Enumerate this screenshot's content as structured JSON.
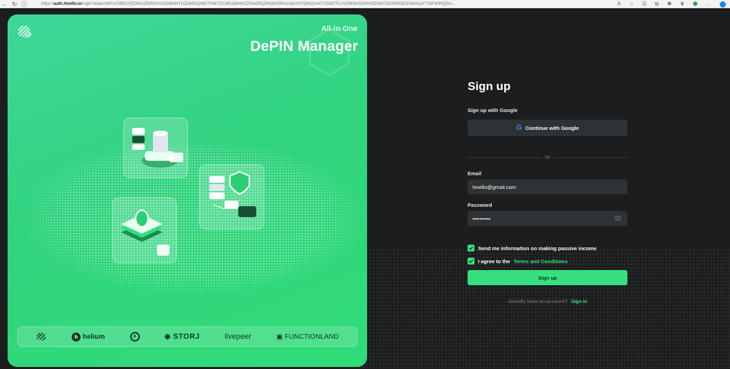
{
  "browser": {
    "url_prefix": "https://",
    "url_host": "auth.hivello.io",
    "url_rest": "/login?state=hKFo2SBEU0Q5MUdZM0hVU1ZkMk94Tk2Zdk9OQ8lDTXMrTEZaRUpWdVZZNa03RjZNKj8mR8UzUjeVVrYjNkQ1A4TU93dTFLUVZMSk05OHVGZHhjY2k25WhtdCEiMmhpYTGtFbHNQSm...",
    "nav_back": "←",
    "nav_reload": "↻",
    "nav_info": "ⓘ",
    "icons": [
      "A",
      "☆",
      "G",
      "⧉",
      "✱",
      "❦",
      "⬢",
      "…"
    ]
  },
  "hero": {
    "subtitle": "All-in-One",
    "title": "DePIN Manager",
    "partners": [
      "helium",
      "STORJ",
      "livepeer",
      "FUNCTIONLAND"
    ],
    "partner_glyphs": {
      "helium": "h",
      "ring": "a",
      "storj": "❋",
      "fl": "▣"
    }
  },
  "form": {
    "title": "Sign up",
    "google_label": "Sign up with Google",
    "google_button": "Continue with Google",
    "google_glyph": "G",
    "or_text": "Or",
    "email_label": "Email",
    "email_value": "hivello@gmail.com",
    "password_label": "Password",
    "password_value": "••••••••••",
    "checkbox_info": "Send me information on making passive income",
    "checkbox_terms_prefix": "I agree to the",
    "checkbox_terms_link": "Terms and Conditions",
    "signup_button": "Sign up",
    "signin_prompt": "Already have an account?",
    "signin_link": "Sign in"
  },
  "colors": {
    "accent": "#36e07f",
    "background": "#1b1d1e",
    "input_bg": "#2e3234",
    "hero_green": "#31d37e"
  }
}
